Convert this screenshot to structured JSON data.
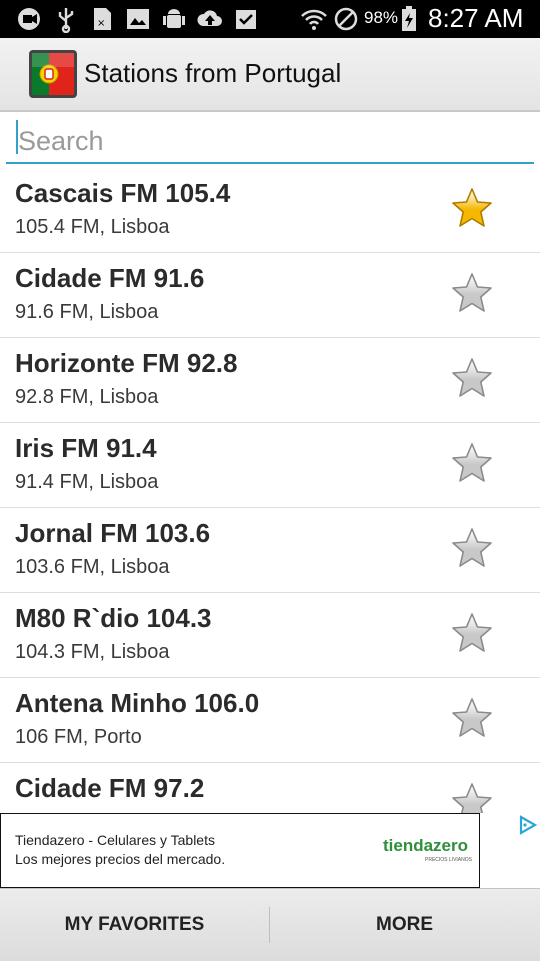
{
  "status_bar": {
    "battery_percent": "98%",
    "time": "8:27 AM"
  },
  "app_bar": {
    "title": "Stations from Portugal",
    "logo_icon": "portugal-flag-icon"
  },
  "search": {
    "placeholder": "Search",
    "value": ""
  },
  "stations": [
    {
      "name": "Cascais FM 105.4",
      "sub": "105.4 FM, Lisboa",
      "favorite": true
    },
    {
      "name": "Cidade FM 91.6",
      "sub": "91.6 FM, Lisboa",
      "favorite": false
    },
    {
      "name": "Horizonte FM 92.8",
      "sub": "92.8 FM, Lisboa",
      "favorite": false
    },
    {
      "name": "Iris FM 91.4",
      "sub": "91.4 FM, Lisboa",
      "favorite": false
    },
    {
      "name": "Jornal FM 103.6",
      "sub": "103.6 FM, Lisboa",
      "favorite": false
    },
    {
      "name": "M80 R`dio 104.3",
      "sub": "104.3 FM, Lisboa",
      "favorite": false
    },
    {
      "name": "Antena Minho 106.0",
      "sub": "106 FM, Porto",
      "favorite": false
    },
    {
      "name": "Cidade FM 97.2",
      "sub": "",
      "favorite": false
    }
  ],
  "ad": {
    "line1": "Tiendazero - Celulares y Tablets",
    "line2": "Los mejores precios del mercado.",
    "logo_text": "tiendazero",
    "logo_sub": "PRECIOS LIVIANOS"
  },
  "bottom_bar": {
    "favorites_label": "MY FAVORITES",
    "more_label": "MORE"
  },
  "colors": {
    "accent": "#33a0c8",
    "star_active": "#f5b800",
    "star_inactive": "#c8c8c8"
  }
}
